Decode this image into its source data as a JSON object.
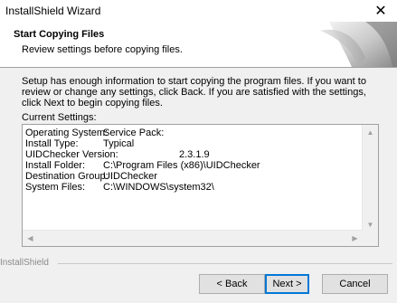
{
  "window": {
    "title": "InstallShield Wizard",
    "close_glyph": "✕"
  },
  "header": {
    "title": "Start Copying Files",
    "subtitle": "Review settings before copying files."
  },
  "intro": "Setup has enough information to start copying the program files.  If you want to review or change any settings, click Back.  If you are satisfied with the settings, click Next to begin copying files.",
  "current_settings_label": "Current Settings:",
  "settings": [
    {
      "key": "Operating System:",
      "value": "Service Pack:"
    },
    {
      "key": "Install Type:",
      "value": "Typical"
    },
    {
      "key": "UIDChecker Version:",
      "value": "2.3.1.9"
    },
    {
      "key": "Install Folder:",
      "value": "C:\\Program Files (x86)\\UIDChecker"
    },
    {
      "key": "Destination Group:",
      "value": "UIDChecker"
    },
    {
      "key": "System Files:",
      "value": "C:\\WINDOWS\\system32\\"
    }
  ],
  "brand": "InstallShield",
  "buttons": {
    "back": "< Back",
    "next": "Next >",
    "cancel": "Cancel"
  },
  "icons": {
    "scroll_up": "scroll-up-arrow-icon",
    "scroll_down": "scroll-down-arrow-icon",
    "scroll_left": "scroll-left-arrow-icon",
    "scroll_right": "scroll-right-arrow-icon"
  }
}
